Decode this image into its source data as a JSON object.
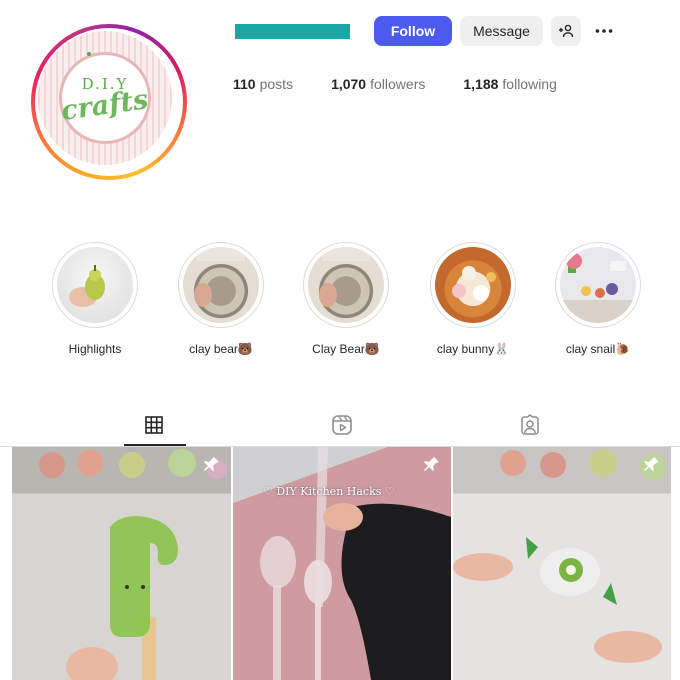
{
  "profile": {
    "logo_top": "D.I.Y",
    "logo_main": "crafts"
  },
  "actions": {
    "follow_label": "Follow",
    "message_label": "Message"
  },
  "stats": [
    {
      "value": "110",
      "label": "posts"
    },
    {
      "value": "1,070",
      "label": "followers"
    },
    {
      "value": "1,188",
      "label": "following"
    }
  ],
  "highlights": [
    {
      "label": "Highlights"
    },
    {
      "label": "clay bear🐻"
    },
    {
      "label": "Clay Bear🐻"
    },
    {
      "label": "clay bunny🐰"
    },
    {
      "label": "clay snail🐌"
    }
  ],
  "tabs": [
    "grid-tab",
    "reels-tab",
    "tagged-tab"
  ],
  "posts": [
    {
      "caption": "",
      "pinned": true
    },
    {
      "caption": "♡ DIY Kitchen Hacks ♡",
      "pinned": true
    },
    {
      "caption": "",
      "pinned": true
    }
  ],
  "colors": {
    "follow_button": "#4b5bf0",
    "username_redaction": "#1aa6a3"
  }
}
